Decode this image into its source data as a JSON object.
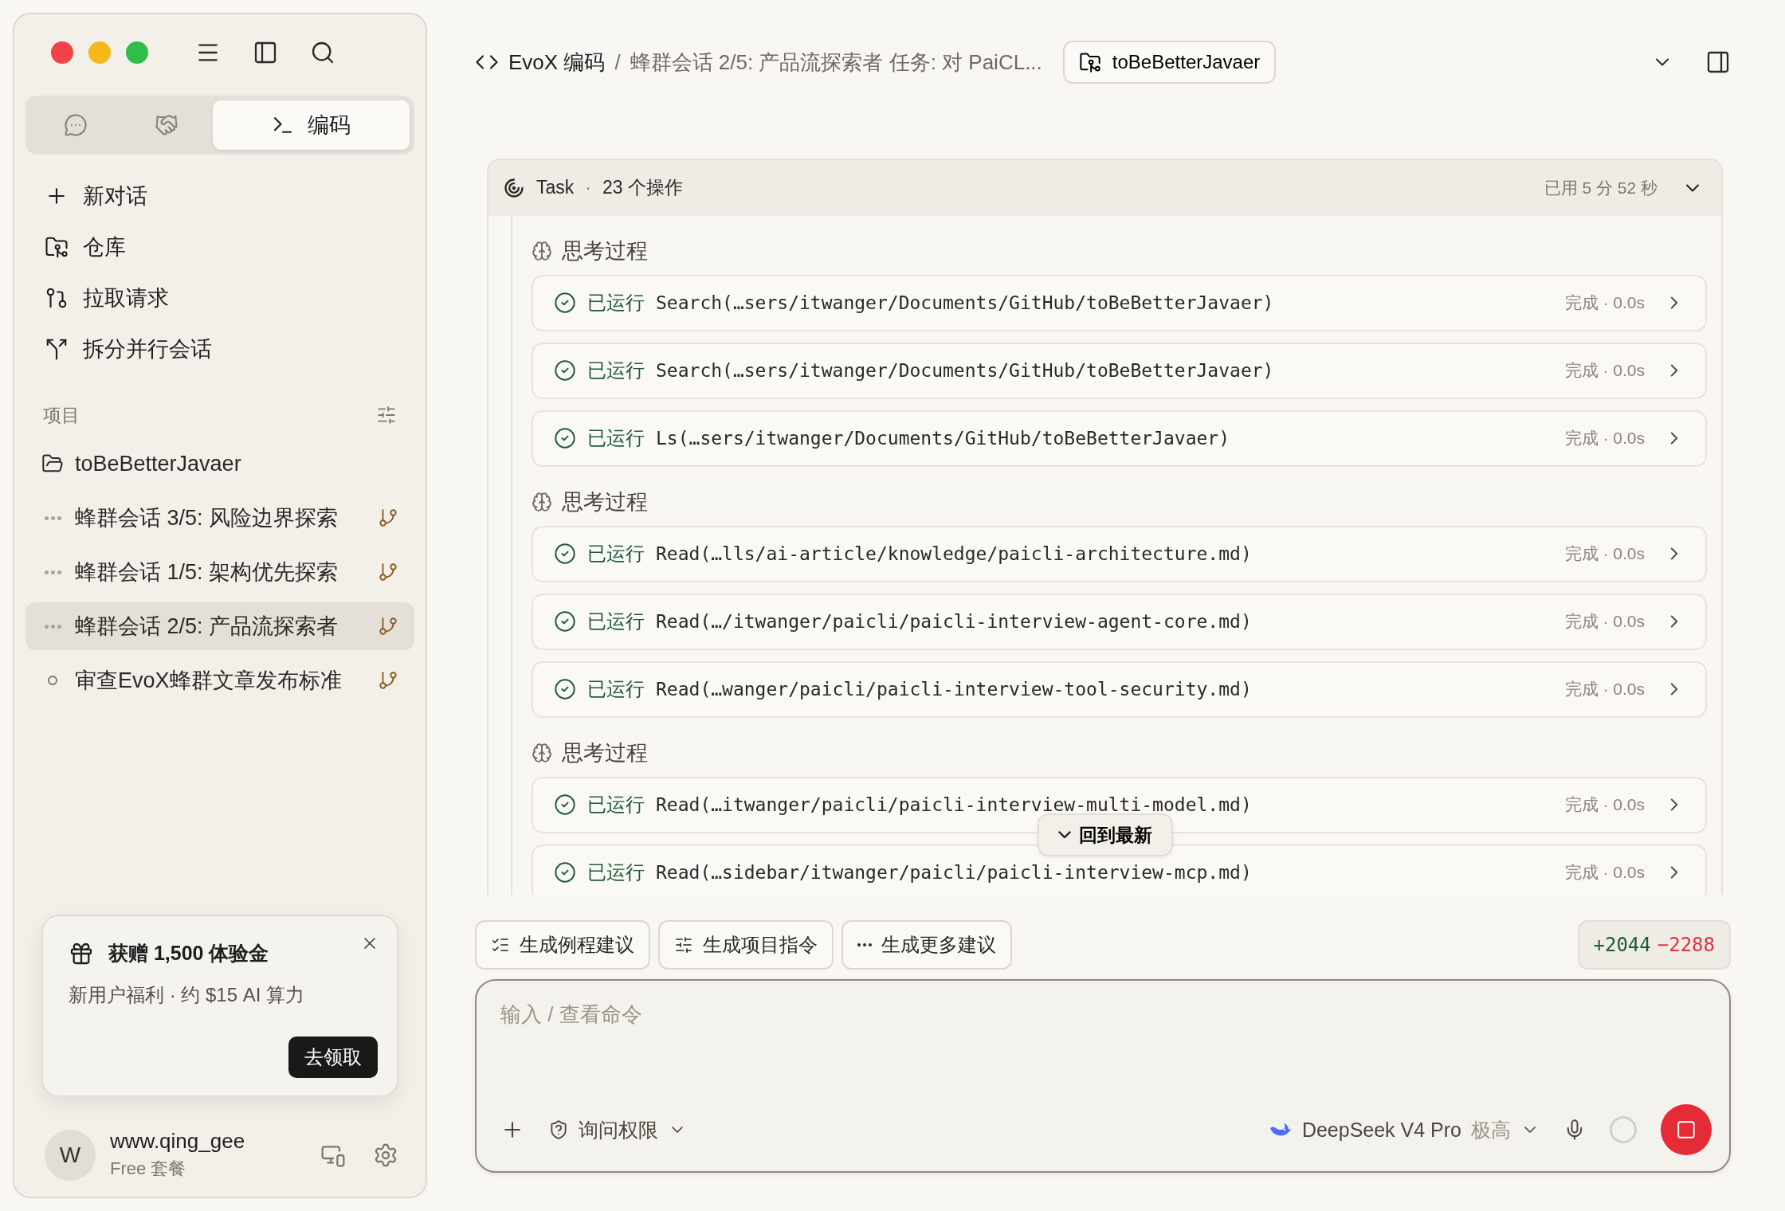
{
  "sidebar": {
    "modes": [
      {
        "kind": "chat",
        "selected": false
      },
      {
        "kind": "agents",
        "selected": false
      },
      {
        "kind": "code",
        "label": "编码",
        "selected": true
      }
    ],
    "nav": [
      {
        "kind": "new",
        "label": "新对话"
      },
      {
        "kind": "repo",
        "label": "仓库"
      },
      {
        "kind": "pull",
        "label": "拉取请求"
      },
      {
        "kind": "split",
        "label": "拆分并行会话"
      }
    ],
    "section_label": "项目",
    "project": "toBeBetterJavaer",
    "sessions": [
      {
        "title": "蜂群会话 3/5: 风险边界探索",
        "kind": "running",
        "selected": false
      },
      {
        "title": "蜂群会话 1/5: 架构优先探索",
        "kind": "running",
        "selected": false
      },
      {
        "title": "蜂群会话 2/5: 产品流探索者",
        "kind": "running",
        "selected": true
      },
      {
        "title": "审查EvoX蜂群文章发布标准",
        "kind": "idle",
        "selected": false
      }
    ],
    "promo": {
      "title": "获赠 1,500 体验金",
      "subtitle": "新用户福利 · 约 $15 AI 算力",
      "button": "去领取"
    },
    "user": {
      "avatar": "W",
      "name": "www.qing_gee",
      "plan": "Free 套餐"
    }
  },
  "header": {
    "root": "EvoX 编码",
    "separator": "/",
    "current": "蜂群会话 2/5: 产品流探索者 任务: 对 PaiCL...",
    "repo": "toBeBetterJavaer"
  },
  "task": {
    "title": "Task",
    "separator": "·",
    "count": "23 个操作",
    "elapsed": "已用 5 分 52 秒",
    "expanded": true,
    "groups": [
      {
        "title": "思考过程",
        "steps": [
          {
            "status": "已运行",
            "command": "Search(…sers/itwanger/Documents/GitHub/toBeBetterJavaer)",
            "result": "完成 · 0.0s"
          },
          {
            "status": "已运行",
            "command": "Search(…sers/itwanger/Documents/GitHub/toBeBetterJavaer)",
            "result": "完成 · 0.0s"
          },
          {
            "status": "已运行",
            "command": "Ls(…sers/itwanger/Documents/GitHub/toBeBetterJavaer)",
            "result": "完成 · 0.0s"
          }
        ]
      },
      {
        "title": "思考过程",
        "steps": [
          {
            "status": "已运行",
            "command": "Read(…lls/ai-article/knowledge/paicli-architecture.md)",
            "result": "完成 · 0.0s"
          },
          {
            "status": "已运行",
            "command": "Read(…/itwanger/paicli/paicli-interview-agent-core.md)",
            "result": "完成 · 0.0s"
          },
          {
            "status": "已运行",
            "command": "Read(…wanger/paicli/paicli-interview-tool-security.md)",
            "result": "完成 · 0.0s"
          }
        ]
      },
      {
        "title": "思考过程",
        "steps": [
          {
            "status": "已运行",
            "command": "Read(…itwanger/paicli/paicli-interview-multi-model.md)",
            "result": "完成 · 0.0s"
          },
          {
            "status": "已运行",
            "command": "Read(…sidebar/itwanger/paicli/paicli-interview-mcp.md)",
            "result": "完成 · 0.0s"
          }
        ]
      }
    ],
    "jump_button": "回到最新"
  },
  "suggestions": [
    {
      "kind": "list",
      "label": "生成例程建议"
    },
    {
      "kind": "sliders",
      "label": "生成项目指令"
    },
    {
      "kind": "more",
      "label": "生成更多建议"
    }
  ],
  "diff": {
    "added": "+2044",
    "removed": "−2288"
  },
  "composer": {
    "placeholder": "输入 / 查看命令",
    "permission": "询问权限",
    "model": "DeepSeek V4 Pro",
    "effort": "极高"
  }
}
